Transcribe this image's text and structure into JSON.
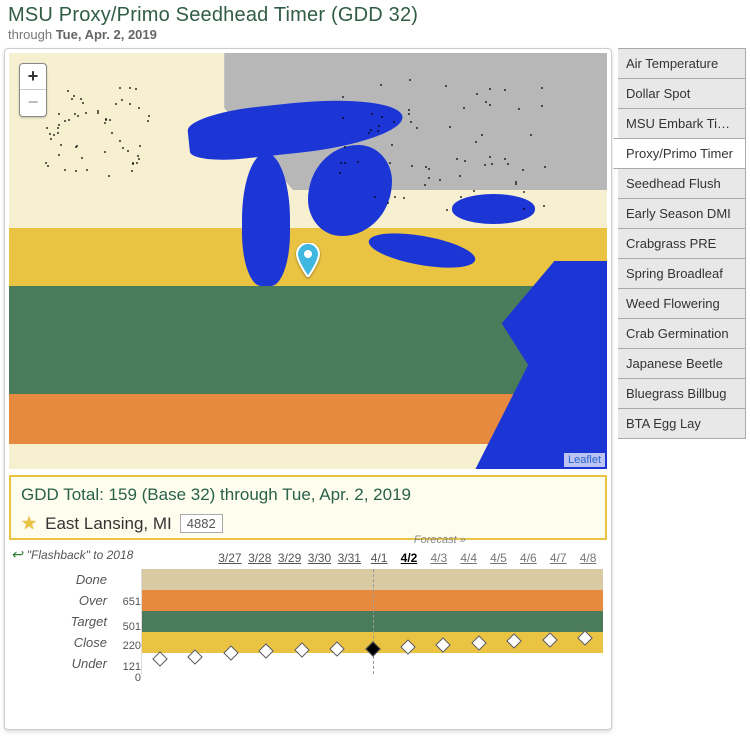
{
  "header": {
    "title": "MSU Proxy/Primo Seedhead Timer (GDD 32)",
    "through_prefix": "through ",
    "through_date": "Tue, Apr. 2, 2019"
  },
  "map": {
    "zoom_in": "+",
    "zoom_out": "−",
    "attribution": "Leaflet",
    "pin_location": "East Lansing, MI"
  },
  "info": {
    "gdd_line": "GDD Total: 159 (Base 32) through Tue, Apr. 2, 2019",
    "location": "East Lansing, MI",
    "code": "4882"
  },
  "timeline": {
    "flashback": "\"Flashback\" to 2018",
    "forecast_label": "Forecast »",
    "dates": [
      "3/27",
      "3/28",
      "3/29",
      "3/30",
      "3/31",
      "4/1",
      "4/2",
      "4/3",
      "4/4",
      "4/5",
      "4/6",
      "4/7",
      "4/8"
    ],
    "today_index": 6,
    "forecast_start_index": 7,
    "bands": [
      {
        "label": "Done",
        "value": "",
        "class": "r-done"
      },
      {
        "label": "",
        "value": "651",
        "class": "r-over",
        "scaleTop": true
      },
      {
        "label": "Over",
        "value": "501",
        "class": "r-over",
        "hidden": true
      },
      {
        "label": "Target",
        "value": "",
        "class": "r-target"
      },
      {
        "label": "Close",
        "value": "220",
        "class": "r-close"
      },
      {
        "label": "Under",
        "value": "121",
        "class": "r-under"
      },
      {
        "label": "",
        "value": "0",
        "class": "",
        "hidden": true
      }
    ],
    "band_labels": [
      "Done",
      "Over",
      "Target",
      "Close",
      "Under"
    ],
    "scale_values": [
      "",
      "651",
      "501",
      "",
      "220",
      "121",
      "0"
    ],
    "marker_positions_pct": [
      86,
      84,
      80,
      78,
      77,
      76,
      76,
      74,
      72,
      70,
      69,
      68,
      66
    ]
  },
  "tabs": [
    {
      "label": "Air Temperature",
      "active": false
    },
    {
      "label": "Dollar Spot",
      "active": false
    },
    {
      "label": "MSU Embark Timer",
      "active": false
    },
    {
      "label": "Proxy/Primo Timer",
      "active": true
    },
    {
      "label": "Seedhead Flush",
      "active": false
    },
    {
      "label": "Early Season DMI",
      "active": false
    },
    {
      "label": "Crabgrass PRE",
      "active": false
    },
    {
      "label": "Spring Broadleaf",
      "active": false
    },
    {
      "label": "Weed Flowering",
      "active": false
    },
    {
      "label": "Crab Germination",
      "active": false
    },
    {
      "label": "Japanese Beetle",
      "active": false
    },
    {
      "label": "Bluegrass Billbug",
      "active": false
    },
    {
      "label": "BTA Egg Lay",
      "active": false
    }
  ]
}
